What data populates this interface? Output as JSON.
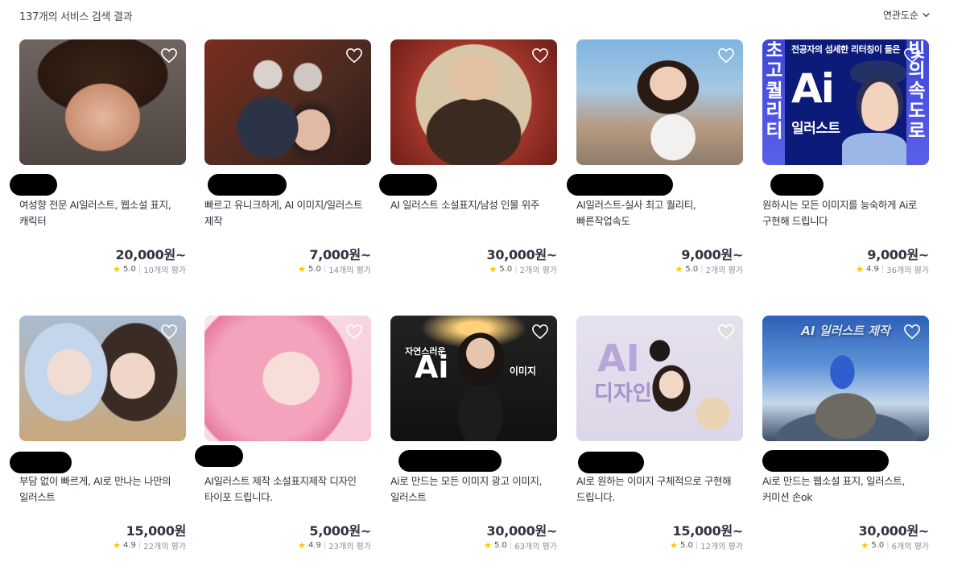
{
  "header": {
    "result_count": "137개의 서비스 검색 결과",
    "sort_label": "연관도순"
  },
  "cards": [
    {
      "title": "여성향 전문 AI일러스트, 웹소설 표지, 캐릭터",
      "price": "20,000원~",
      "score": "5.0",
      "reviews": "10개의 평가",
      "thumb_desc": "portrait of dark-haired young man"
    },
    {
      "title": "빠르고 유니크하게, AI 이미지/일러스트 제작",
      "price": "7,000원~",
      "score": "5.0",
      "reviews": "14개의 평가",
      "thumb_desc": "two silver-haired characters on a red sofa"
    },
    {
      "title": "AI 일러스트 소설표지/남성 인물 위주",
      "price": "30,000원~",
      "score": "5.0",
      "reviews": "2개의 평가",
      "thumb_desc": "man in ornate armor at a table"
    },
    {
      "title": "AI일러스트-실사 최고 퀄리티,빠른작업속도",
      "price": "9,000원~",
      "score": "5.0",
      "reviews": "2개의 평가",
      "thumb_desc": "woman in front of castle theme park"
    },
    {
      "title": "원하시는 모든 이미지를 능숙하게 Ai로 구현해 드립니다",
      "price": "9,000원~",
      "score": "4.9",
      "reviews": "36개의 평가",
      "thumb_desc": "AI illustration promo banner"
    },
    {
      "title": "부담 없이 빠르게, AI로 만나는 나만의 일러스트",
      "price": "15,000원",
      "score": "4.9",
      "reviews": "22개의 평가",
      "thumb_desc": "two elf women with ornate jewelry"
    },
    {
      "title": "AI일러스트 제작 소설표지제작 디자인 타이포 드립니다.",
      "price": "5,000원~",
      "score": "4.9",
      "reviews": "23개의 평가",
      "thumb_desc": "pink-haired girl portrait"
    },
    {
      "title": "Ai로 만드는 모든 이미지 광고 이미지, 일러스트",
      "price": "30,000원~",
      "score": "5.0",
      "reviews": "63개의 평가",
      "thumb_desc": "woman on stage with AI text"
    },
    {
      "title": "AI로 원하는 이미지 구체적으로 구현해 드립니다.",
      "price": "15,000원~",
      "score": "5.0",
      "reviews": "12개의 평가",
      "thumb_desc": "AI design banner with characters and dog"
    },
    {
      "title": "Ai로 만드는 웹소설 표지, 일러스트, 커미션 손ok",
      "price": "30,000원~",
      "score": "5.0",
      "reviews": "6개의 평가",
      "thumb_desc": "blue-haired girl over fantasy landscape"
    }
  ],
  "thumb_text": {
    "card5_left": "초고퀄리티",
    "card5_right": "빛의속도로",
    "card5_top": "전공자의 섬세한 리터칭이 들은",
    "card5_ai": "Ai",
    "card5_sub": "일러스트",
    "card8_left": "자연스러운",
    "card8_ai": "Ai",
    "card8_right": "이미지",
    "card9_ai": "AI",
    "card9_sub": "디자인",
    "card10_title": "AI 일러스트 제작"
  },
  "colors": {
    "price": "#303441",
    "star": "#ffc400",
    "text_muted": "#8a8d94"
  }
}
